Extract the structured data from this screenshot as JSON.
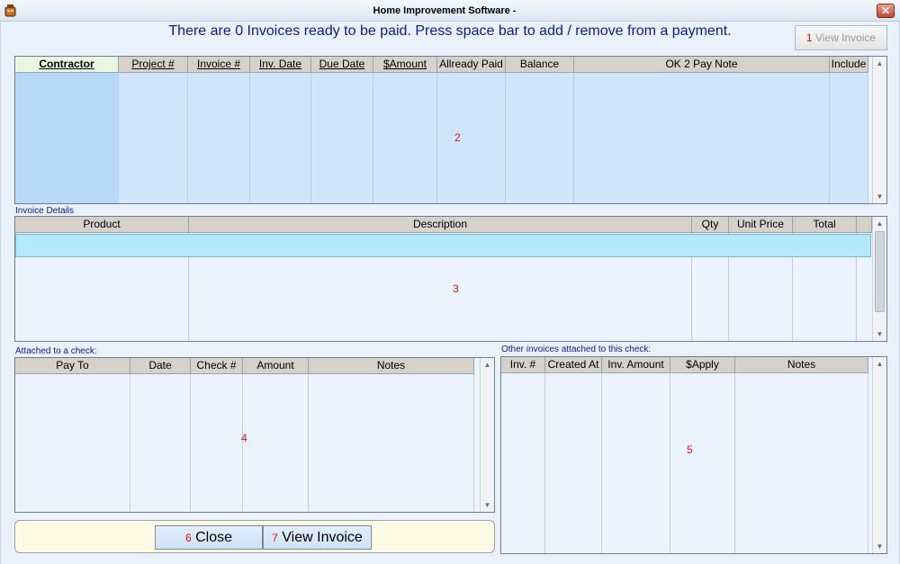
{
  "window": {
    "title": "Home Improvement Software -",
    "close_glyph": "✕"
  },
  "headline": "There are 0 Invoices ready to be paid. Press space bar to add / remove from a payment.",
  "top_button": {
    "number": "1",
    "label": "View Invoice"
  },
  "invoices_grid": {
    "marker": "2",
    "columns": [
      "Contractor",
      "Project #",
      "Invoice #",
      "Inv. Date",
      "Due Date",
      "$Amount",
      "Allready Paid",
      "Balance",
      "OK 2 Pay Note",
      "Include"
    ]
  },
  "details": {
    "label": "Invoice Details",
    "marker": "3",
    "columns": [
      "Product",
      "Description",
      "Qty",
      "Unit Price",
      "Total"
    ]
  },
  "check": {
    "label": "Attached to a check:",
    "marker": "4",
    "columns": [
      "Pay To",
      "Date",
      "Check #",
      "Amount",
      "Notes"
    ]
  },
  "other": {
    "label": "Other invoices attached to this check:",
    "marker": "5",
    "columns": [
      "Inv. #",
      "Created At",
      "Inv. Amount",
      "$Apply",
      "Notes"
    ]
  },
  "buttons": {
    "close": {
      "number": "6",
      "label": "Close"
    },
    "view": {
      "number": "7",
      "label": "View Invoice"
    }
  },
  "scroll": {
    "up": "▲",
    "down": "▼"
  }
}
